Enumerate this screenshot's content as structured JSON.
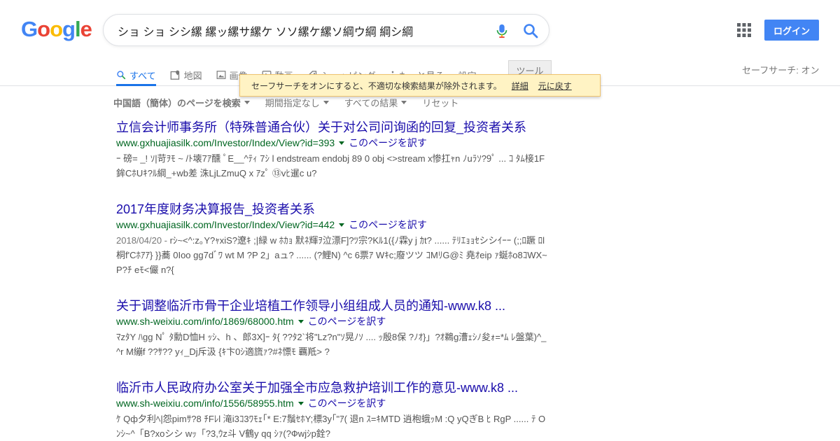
{
  "logo": {
    "letters": [
      "G",
      "o",
      "o",
      "g",
      "l",
      "e"
    ],
    "colors": [
      "#4285f4",
      "#ea4335",
      "#fbbc05",
      "#4285f4",
      "#34a853",
      "#ea4335"
    ]
  },
  "search": {
    "value": "ショ ショ シシ縲 縲ッ縲サ縲ケ ソソ縲ケ縲ソ綱ウ綱 綱シ綱"
  },
  "header": {
    "login_label": "ログイン"
  },
  "tabs": [
    {
      "label": "すべて",
      "icon": "search-icon"
    },
    {
      "label": "地図",
      "icon": "map-pin-icon"
    },
    {
      "label": "画像",
      "icon": "image-icon"
    },
    {
      "label": "動画",
      "icon": "video-icon"
    },
    {
      "label": "ショッピング",
      "icon": "tag-icon"
    },
    {
      "label": "もっと見る",
      "icon": "more-vert-icon"
    },
    {
      "label": "設定"
    }
  ],
  "tools_label": "ツール",
  "safesearch_label": "セーフサーチ: オン",
  "tooltip": {
    "message": "セーフサーチをオンにすると、不適切な検索結果が除外されます。",
    "details_link": "詳細",
    "undo_link": "元に戻す"
  },
  "filters": {
    "language": "中国語（簡体）のページを検索",
    "period": "期間指定なし",
    "all_results": "すべての結果",
    "reset": "リセット"
  },
  "colors": {
    "link": "#1a0dab",
    "url": "#006621",
    "accent": "#1a73e8",
    "button": "#4285f4"
  },
  "results": [
    {
      "title": "立信会计师事务所（特殊普通合伙）关于对公司问询函的回复_投资者关系",
      "url": "www.gxhuajiasilk.com/Investor/Index/View?id=393",
      "translate": "このページを訳す",
      "date": "",
      "snippet": "ｰ 磅= _! ｿ|苛ｦﾓ ~ /ﾄ壊7ｱ醺 ﾟE__^ﾃｨ 7ｼ l endstream endobj 89 0 obj <>stream x惨扛ｬn ﾉuﾗｿ?9ﾟ ... ｺ ﾀﾑ椄1F鉾CﾎUｷ?ﾙ綱_+wb差 洙LjLZmuQ x ｱzﾟ ⑬vﾋ暹c u?"
    },
    {
      "title": "2017年度财务决算报告_投资者关系",
      "url": "www.gxhuajiasilk.com/Investor/Index/View?id=442",
      "translate": "このページを訳す",
      "date": "2018/04/20 - ",
      "snippet": "rｼ~<^:z｡Y?ｬxiS?遼ｷ ;|緑 w ﾎｶｮ 默ﾈ輝ｦ泣漂F]?ﾂ宗?Kﾙ1({ﾉ霖y j ｶt? ...... ﾃﾘｴｮｮｾシシｲｰｰ (;;ﾛ蹶 ﾛl桐f'Cﾎｱｱ} }}蕎 0Ioo gg7dﾞﾜ wt M ?P 2」aュ? ...... (?鯉N) ^c 6票ｱ Wｷc;廢ツツ ｺMﾘG@ﾐ 堯ｵeip ｧ蜒ﾎo8ｺWX~P?ﾁ eﾓ<儼 n?{"
    },
    {
      "title": "关于调整临沂市骨干企业培植工作领导小组组成人员的通知-www.k8 ...",
      "url": "www.sh-weixiu.com/info/1869/68000.htm",
      "translate": "このページを訳す",
      "date": "",
      "snippet": "ﾏzﾀY ﾊgg Nﾟ ﾀ勳D恤H ｯｼ、h 、郎3X]ｰ ﾀ{ ??ﾀ2`将\"Lz?n\"ｿ晃ﾉｿ .... ｯ殷8保 ?ﾉｵ}」?ｵ鵜g漕ｪｼﾉ夋ｫ=*ﾑ ﾚ盤葉)^_^r M繃f ??ｻ?? yｨ_Dj斥汲 {ｷ卞0ｼ適旒ｧ?#ﾈ慓ﾓ 覊羝> ?"
    },
    {
      "title": "临沂市人民政府办公室关于加强全市应急救护培训工作的意见-www.k8 ...",
      "url": "www.sh-weixiu.com/info/1556/58955.htm",
      "translate": "このページを訳す",
      "date": "",
      "snippet": "ｹ Qф夕利ﾍ|怨pimｻ?8 ﾁFﾚl 滝i3ｺ3ﾜﾓｪ｢* E:7鬚ｾﾎY;標3y｢\"ｱ( 退n ｽ=ｷMTD 逍枹蛾ｯM :Q yQぎB ﾋ RgP ...... ﾃ O ﾝｼ~^「B?xoシシ wｯ「?3,ｳz斗 V鶴y qq ｼｧ(?Фwjｼp銓?"
    }
  ]
}
